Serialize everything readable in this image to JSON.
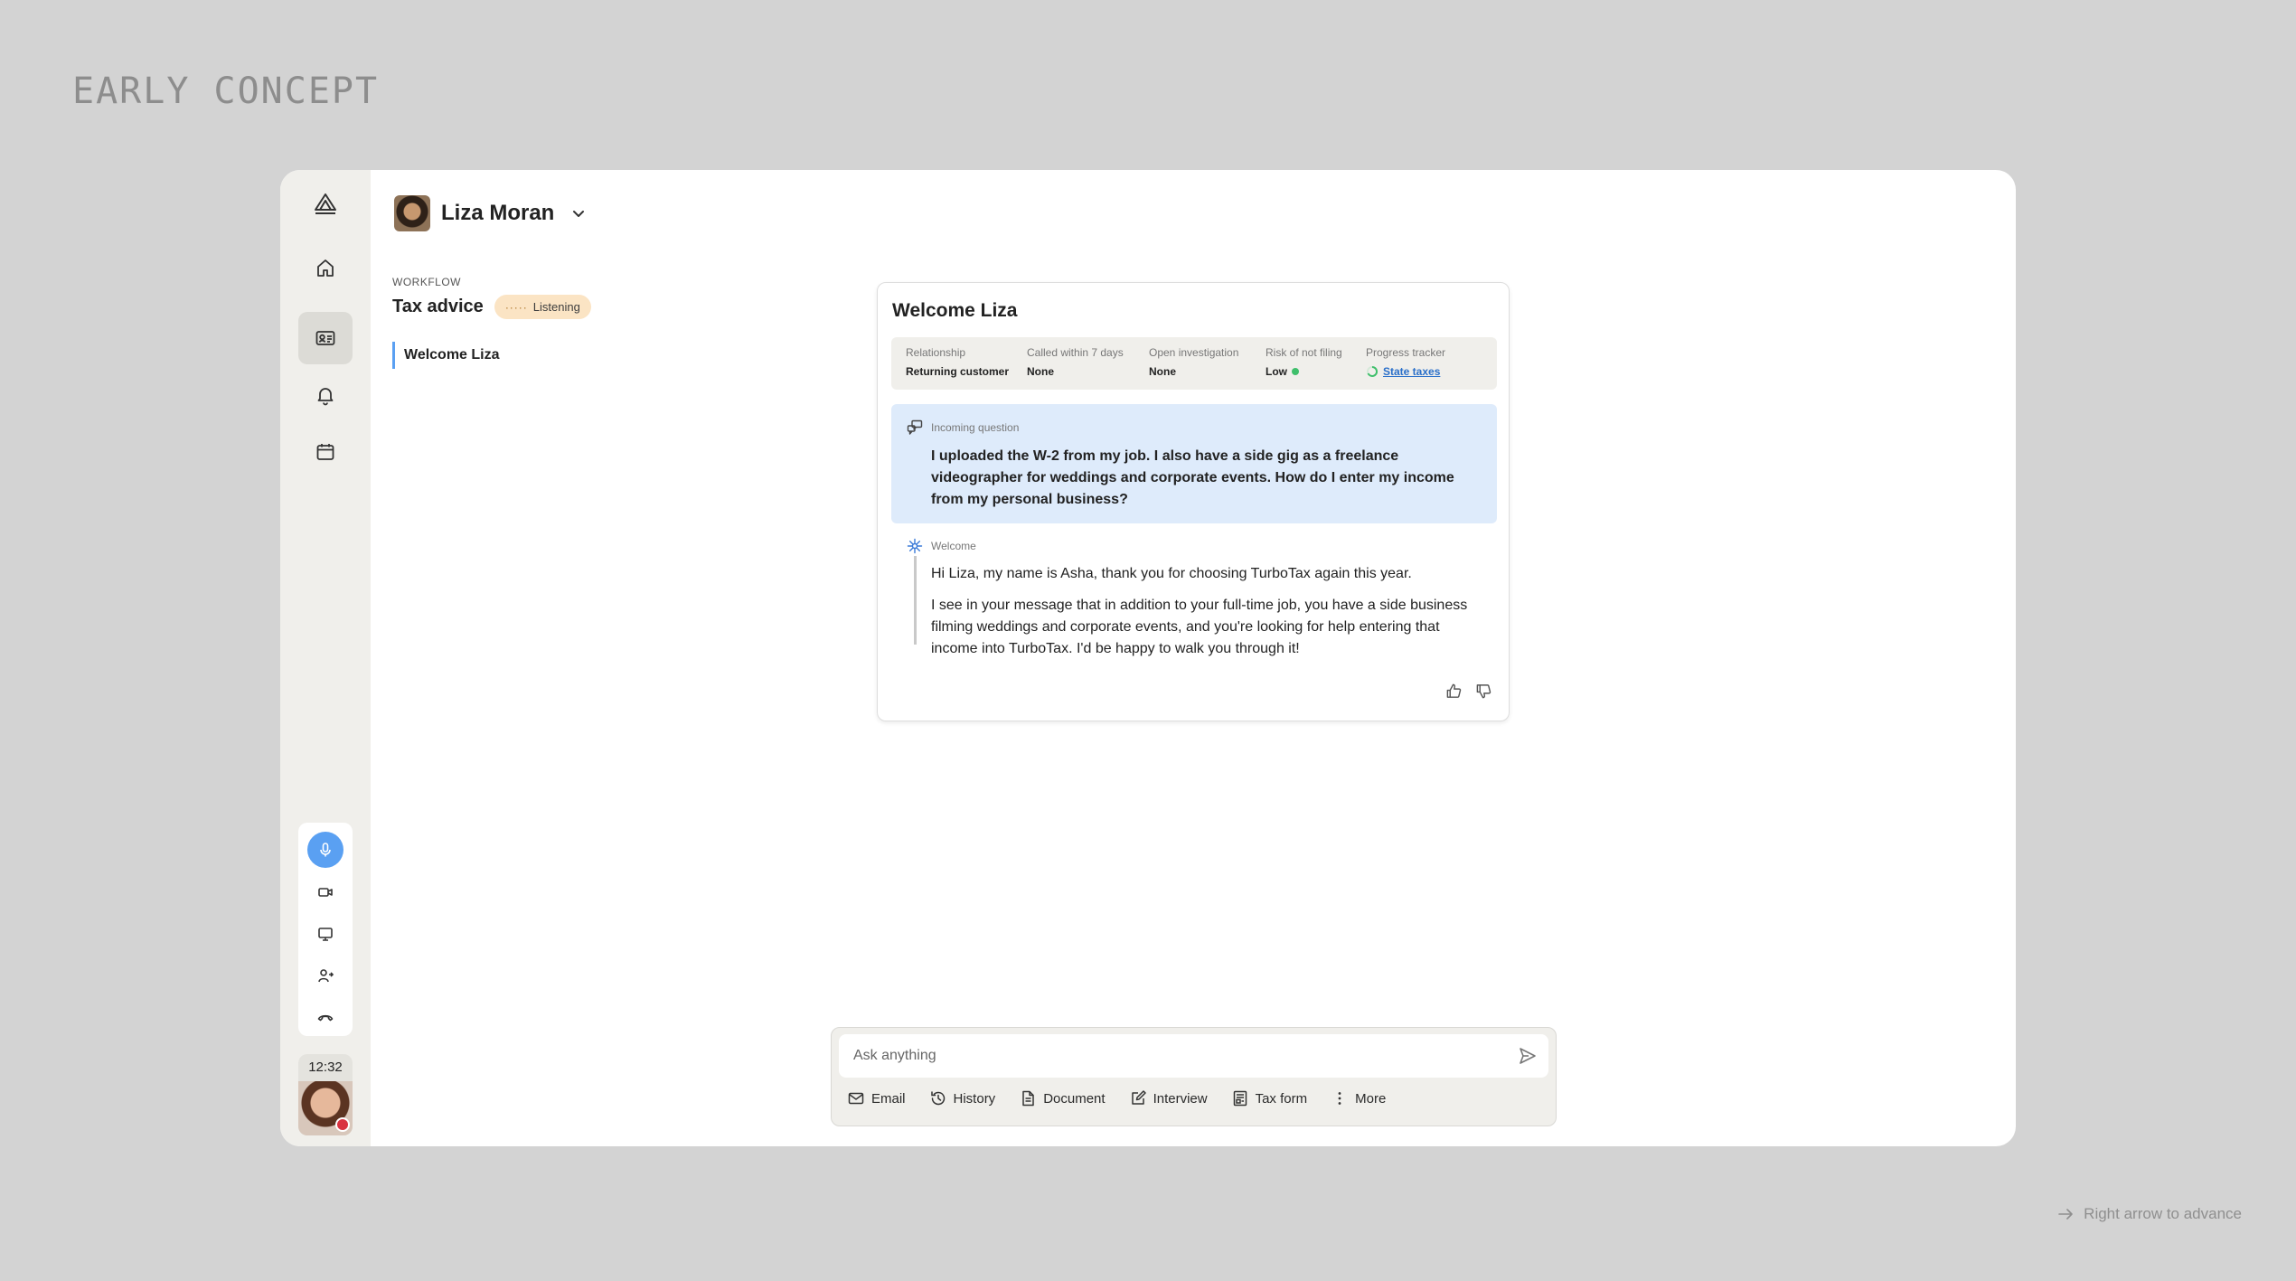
{
  "page_label": "EARLY CONCEPT",
  "advance_hint": "Right arrow to advance",
  "rail": {
    "logo_icon": "app-logo-icon",
    "nav": [
      {
        "icon": "home-icon"
      },
      {
        "icon": "contact-card-icon",
        "active": true
      },
      {
        "icon": "bell-icon"
      },
      {
        "icon": "calendar-icon"
      }
    ],
    "call_controls": [
      "microphone-icon",
      "video-icon",
      "screen-share-icon",
      "transfer-user-icon",
      "hang-up-icon"
    ],
    "agent_time": "12:32"
  },
  "customer": {
    "name": "Liza Moran"
  },
  "workflow": {
    "label": "WORKFLOW",
    "title": "Tax advice",
    "status": "Listening",
    "status_dots": "·····",
    "steps": [
      "Welcome Liza"
    ]
  },
  "card": {
    "title": "Welcome Liza",
    "facts": [
      {
        "label": "Relationship",
        "value": "Returning customer"
      },
      {
        "label": "Called within 7 days",
        "value": "None"
      },
      {
        "label": "Open investigation",
        "value": "None"
      },
      {
        "label": "Risk of not filing",
        "value": "Low"
      },
      {
        "label": "Progress tracker",
        "value": "State taxes"
      }
    ],
    "question": {
      "label": "Incoming question",
      "text": "I uploaded the W-2 from my job.  I also have a side gig as a freelance videographer for weddings and corporate events. How do I enter my income from my personal business?"
    },
    "response": {
      "label": "Welcome",
      "paragraph_1": "Hi Liza, my name is Asha, thank you for choosing TurboTax again this year.",
      "paragraph_2": "I see in your message that in addition to your full-time job, you have a side business filming weddings and corporate events, and you're looking for help entering that income into TurboTax. I'd be happy to walk you through it!"
    }
  },
  "composer": {
    "placeholder": "Ask anything",
    "value": "",
    "tools": [
      {
        "label": "Email",
        "icon": "mail-icon"
      },
      {
        "label": "History",
        "icon": "history-icon"
      },
      {
        "label": "Document",
        "icon": "document-icon"
      },
      {
        "label": "Interview",
        "icon": "interview-icon"
      },
      {
        "label": "Tax form",
        "icon": "tax-form-icon"
      },
      {
        "label": "More",
        "icon": "more-vertical-icon"
      }
    ]
  },
  "colors": {
    "accent": "#5aa0f2",
    "listening_bg": "#fbe4c4",
    "question_bg": "#deebfb",
    "risk_low": "#3fbf6b",
    "alert": "#d93341"
  }
}
